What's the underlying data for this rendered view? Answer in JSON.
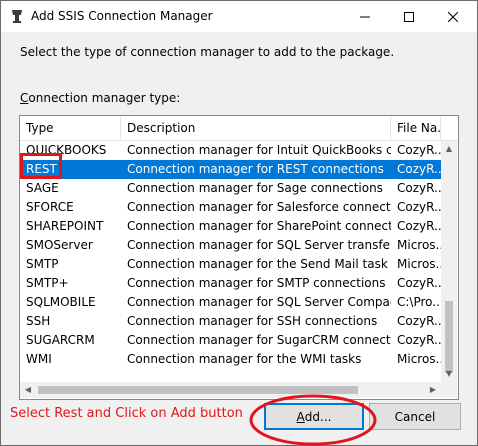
{
  "window": {
    "title": "Add SSIS Connection Manager",
    "minimize_glyph": "—",
    "maximize_glyph": "☐",
    "close_glyph": "✕"
  },
  "instruction": "Select the type of connection manager to add to the package.",
  "list_label": {
    "first_char": "C",
    "rest": "onnection manager type:"
  },
  "columns": [
    "Type",
    "Description",
    "File Na..."
  ],
  "rows": [
    {
      "type": "QUICKBOOKS",
      "description": "Connection manager for Intuit QuickBooks co...",
      "file": "CozyR..."
    },
    {
      "type": "REST",
      "description": "Connection manager for REST connections",
      "file": "CozyR..."
    },
    {
      "type": "SAGE",
      "description": "Connection manager for Sage connections",
      "file": "CozyR..."
    },
    {
      "type": "SFORCE",
      "description": "Connection manager for Salesforce connections",
      "file": "CozyR..."
    },
    {
      "type": "SHAREPOINT",
      "description": "Connection manager for SharePoint connections",
      "file": "CozyR..."
    },
    {
      "type": "SMOServer",
      "description": "Connection manager for SQL Server transfer ta...",
      "file": "Micros..."
    },
    {
      "type": "SMTP",
      "description": "Connection manager for the Send Mail task",
      "file": "Micros..."
    },
    {
      "type": "SMTP+",
      "description": "Connection manager for SMTP connections",
      "file": "CozyR..."
    },
    {
      "type": "SQLMOBILE",
      "description": "Connection manager for SQL Server Compact ...",
      "file": "C:\\Pro..."
    },
    {
      "type": "SSH",
      "description": "Connection manager for SSH connections",
      "file": "CozyR..."
    },
    {
      "type": "SUGARCRM",
      "description": "Connection manager for SugarCRM connections",
      "file": "CozyR..."
    },
    {
      "type": "WMI",
      "description": "Connection manager for the WMI tasks",
      "file": "Micros..."
    }
  ],
  "selected_type": "REST",
  "annotation": "Select Rest and Click on Add button",
  "buttons": {
    "add": {
      "underlined": "A",
      "rest": "dd..."
    },
    "cancel": "Cancel"
  },
  "colors": {
    "selection": "#0078d7",
    "annotation": "#e0161b"
  }
}
